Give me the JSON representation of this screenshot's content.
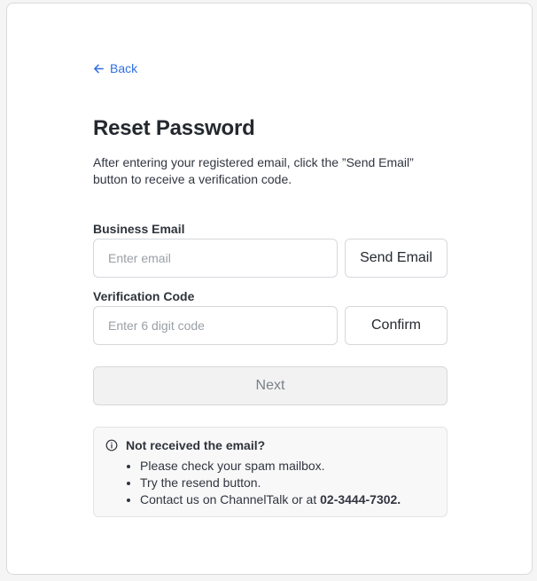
{
  "nav": {
    "back_label": "Back"
  },
  "header": {
    "title": "Reset Password",
    "description": "After entering your registered email, click the ”Send Email” button to receive a verification code."
  },
  "email": {
    "label": "Business Email",
    "placeholder": "Enter email",
    "value": "",
    "button_label": "Send Email"
  },
  "code": {
    "label": "Verification Code",
    "placeholder": "Enter 6 digit code",
    "value": "",
    "button_label": "Confirm"
  },
  "next_button_label": "Next",
  "notice": {
    "title": "Not received the email?",
    "items": [
      "Please check your spam mailbox.",
      "Try the resend button."
    ],
    "contact_prefix": "Contact us on ChannelTalk or at ",
    "contact_phone": "02-3444-7302."
  },
  "colors": {
    "accent": "#2f6fe0",
    "border": "#d6d8dc",
    "notice_bg": "#f8f8f8"
  },
  "icons": {
    "back": "arrow-left-icon",
    "notice": "info-circle-icon"
  }
}
